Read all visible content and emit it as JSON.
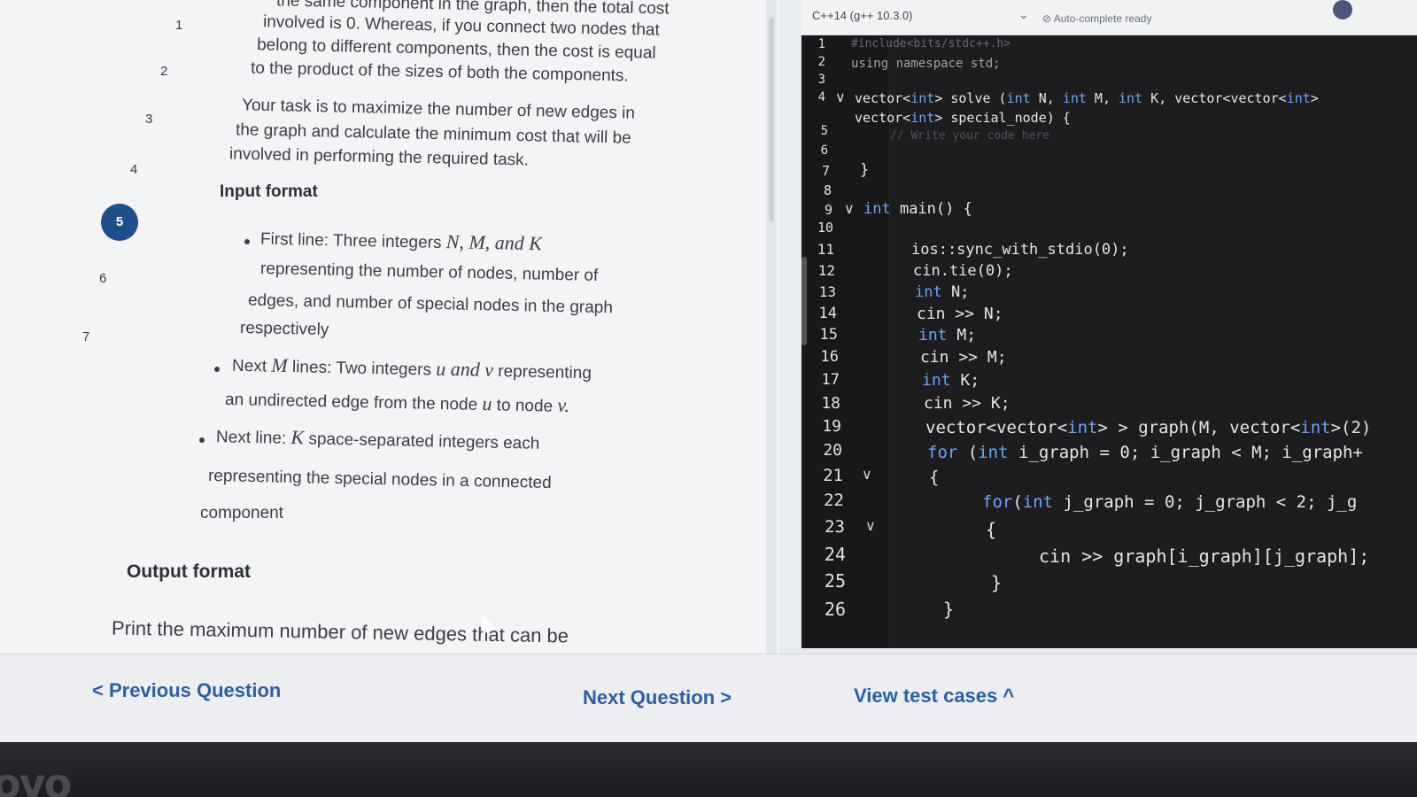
{
  "question_nav": {
    "numbers": [
      "1",
      "2",
      "3",
      "4",
      "5",
      "6",
      "7"
    ],
    "current_index": 4
  },
  "problem": {
    "lines": [
      "the same component in the graph, then the total cost",
      "involved is 0. Whereas, if you connect two nodes that",
      "belong to different components, then the cost is equal",
      "to the product of the sizes of both the components.",
      "Your task is to maximize the number of new edges in",
      "the graph and calculate the minimum cost that will be",
      "involved in performing the required task."
    ],
    "input_heading": "Input format",
    "input_items": [
      {
        "prefix": "First line: Three integers ",
        "math": "N, M, and K",
        "rest": [
          "representing the number of nodes, number of",
          "edges, and number of special nodes in the graph",
          "respectively"
        ]
      },
      {
        "prefix": "Next ",
        "math": "M",
        "mid": " lines: Two integers ",
        "math2": "u and v",
        "suffix": " representing",
        "rest_pre": "an undirected edge from the node ",
        "rest_math": "u",
        "rest_mid": " to node ",
        "rest_math2": "v."
      },
      {
        "prefix": "Next line: ",
        "math": "K",
        "suffix": " space-separated integers each",
        "rest": [
          "representing the special nodes in a connected",
          "component"
        ]
      }
    ],
    "output_heading": "Output format",
    "output_line": "Print the maximum number of new edges that can be"
  },
  "nav": {
    "previous": "< Previous Question",
    "next": "Next Question >",
    "view_tests": "View test cases ^"
  },
  "editor": {
    "language": "C++14 (g++ 10.3.0)",
    "autocomplete": "Auto-complete ready",
    "lines": [
      "#include<bits/stdc++.h>",
      "using namespace std;",
      "",
      "vector<int> solve (int N, int M, int K, vector<vector<int>",
      "vector<int> special_node) {",
      "// Write your code here",
      "}",
      "",
      "int main() {",
      "",
      "ios::sync_with_stdio(0);",
      "cin.tie(0);",
      "int N;",
      "cin >> N;",
      "int M;",
      "cin >> M;",
      "int K;",
      "cin >> K;",
      "vector<vector<int> > graph(M, vector<int>(2)",
      "for (int i_graph = 0; i_graph < M; i_graph+",
      "{",
      "for(int j_graph = 0; j_graph < 2; j_g",
      "{",
      "cin >> graph[i_graph][j_graph];",
      "}",
      "}"
    ],
    "line_numbers": [
      "1",
      "2",
      "3",
      "4",
      "5",
      "6",
      "7",
      "8",
      "9",
      "10",
      "11",
      "12",
      "13",
      "14",
      "15",
      "16",
      "17",
      "18",
      "19",
      "20",
      "21",
      "22",
      "23",
      "24",
      "25",
      "26"
    ]
  },
  "brand_text": "ovo"
}
